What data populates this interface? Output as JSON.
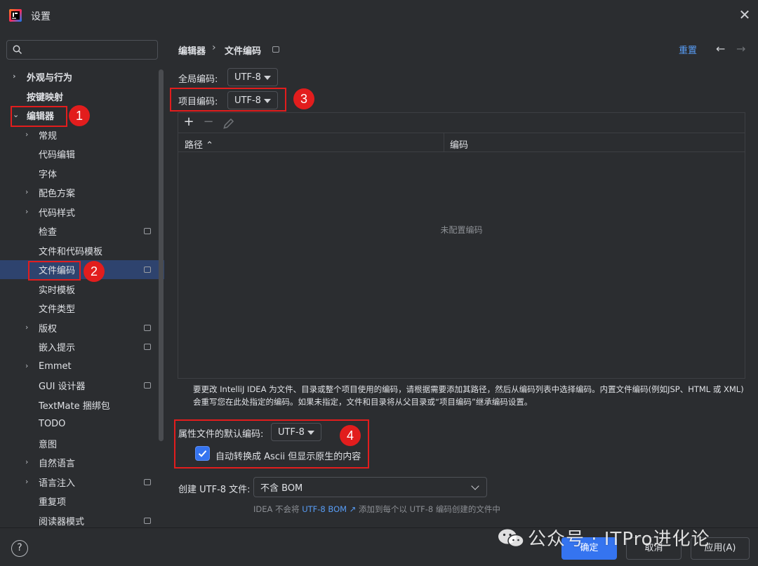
{
  "window": {
    "title": "设置"
  },
  "search": {
    "placeholder": "",
    "value": ""
  },
  "sidebar": {
    "items": [
      {
        "label": "外观与行为"
      },
      {
        "label": "按键映射"
      },
      {
        "label": "编辑器"
      },
      {
        "label": "常规"
      },
      {
        "label": "代码编辑"
      },
      {
        "label": "字体"
      },
      {
        "label": "配色方案"
      },
      {
        "label": "代码样式"
      },
      {
        "label": "检查"
      },
      {
        "label": "文件和代码模板"
      },
      {
        "label": "文件编码"
      },
      {
        "label": "实时模板"
      },
      {
        "label": "文件类型"
      },
      {
        "label": "版权"
      },
      {
        "label": "嵌入提示"
      },
      {
        "label": "Emmet"
      },
      {
        "label": "GUI 设计器"
      },
      {
        "label": "TextMate 捆绑包"
      },
      {
        "label": "TODO"
      },
      {
        "label": "意图"
      },
      {
        "label": "自然语言"
      },
      {
        "label": "语言注入"
      },
      {
        "label": "重复项"
      },
      {
        "label": "阅读器模式"
      }
    ]
  },
  "breadcrumb": {
    "parent": "编辑器",
    "separator": "›",
    "current": "文件编码"
  },
  "header": {
    "reset_label": "重置",
    "back_icon": "←",
    "forward_icon": "→"
  },
  "global_encoding": {
    "label": "全局编码:",
    "value": "UTF-8"
  },
  "project_encoding": {
    "label": "项目编码:",
    "value": "UTF-8"
  },
  "table": {
    "toolbar": {
      "add": "+",
      "remove": "−"
    },
    "columns": [
      "路径 ⌃",
      "编码"
    ],
    "empty_text": "未配置编码"
  },
  "description": "要更改 IntelliJ IDEA 为文件、目录或整个项目使用的编码，请根据需要添加其路径，然后从编码列表中选择编码。内置文件编码(例如JSP、HTML 或 XML)会重写您在此处指定的编码。如果未指定，文件和目录将从父目录或“项目编码”继承编码设置。",
  "properties_encoding": {
    "label": "属性文件的默认编码:",
    "value": "UTF-8"
  },
  "ascii_checkbox": {
    "label": "自动转换成 Ascii 但显示原生的内容",
    "checked": true
  },
  "bom": {
    "label": "创建 UTF-8 文件:",
    "value": "不含 BOM"
  },
  "hint": {
    "prefix": "IDEA 不会将",
    "link": "UTF-8 BOM ↗",
    "suffix": "添加到每个以 UTF-8 编码创建的文件中"
  },
  "annotations": {
    "badge1": "1",
    "badge2": "2",
    "badge3": "3",
    "badge4": "4"
  },
  "buttons": {
    "ok": "确定",
    "cancel": "取消",
    "apply": "应用(A)",
    "help": "?"
  },
  "watermark": "公众号 · ITPro进化论",
  "colors": {
    "accent": "#3574f0",
    "link": "#589df6",
    "highlight_red": "#e21d1d",
    "selection": "#2e436e",
    "background": "#2b2d30"
  }
}
